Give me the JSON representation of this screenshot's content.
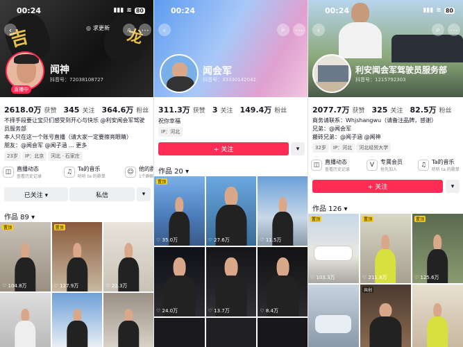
{
  "status": {
    "time": "00:24",
    "battery": "80"
  },
  "p1": {
    "buttons": {
      "refresh": "求更新"
    },
    "name": "闻神",
    "id": "抖音号：72038108727",
    "live": "直播中",
    "stats": [
      {
        "num": "2618.0万",
        "label": "获赞"
      },
      {
        "num": "345",
        "label": "关注"
      },
      {
        "num": "364.6万",
        "label": "粉丝"
      }
    ],
    "bio1": "不择手段要让宝贝们感受到开心与快乐 @利安闻会军驾驶员服务部",
    "bio2": "本人只在这一个账号直播（请大家一定要擦亮眼睛）",
    "bio3": "朋友：@闻会军 @闻子涵 ... 更多",
    "tags": [
      "23岁",
      "IP：北京",
      "河北 · 石家庄"
    ],
    "icons": [
      {
        "t1": "直播动态",
        "t2": "查看历史记录"
      },
      {
        "t1": "Ta的音乐",
        "t2": "听听 ta 的歌单"
      },
      {
        "t1": "他的群",
        "t2": "1个群聊"
      }
    ],
    "follow_btn": "已关注 ▾",
    "msg_btn": "私信",
    "works": "作品 89 ▾",
    "likes": [
      "104.8万",
      "127.9万",
      "22.3万"
    ],
    "pin": "置顶"
  },
  "p2": {
    "name": "闻会军",
    "id": "抖音号：33330142042",
    "stats": [
      {
        "num": "311.3万",
        "label": "获赞"
      },
      {
        "num": "3",
        "label": "关注"
      },
      {
        "num": "149.4万",
        "label": "粉丝"
      }
    ],
    "bio": "祝你幸福",
    "tags": [
      "IP：河北"
    ],
    "follow_btn": "+ 关注",
    "works": "作品 20 ▾",
    "likes": [
      "35.0万",
      "27.6万",
      "11.5万",
      "24.0万",
      "13.7万",
      "8.4万"
    ],
    "pin": "置顶"
  },
  "p3": {
    "name": "利安闻会军驾驶员服务部",
    "id": "抖音号：1215792303",
    "stats": [
      {
        "num": "2077.7万",
        "label": "获赞"
      },
      {
        "num": "325",
        "label": "关注"
      },
      {
        "num": "82.5万",
        "label": "粉丝"
      }
    ],
    "bio1": "商务请联系：Whjshangwu（请备注品牌，感谢）",
    "bio2": "兄弟：@闻会军",
    "bio3": "搬砖兄弟：@闻子涵 @闻神",
    "tags": [
      "32岁",
      "IP：河北",
      "河北经贸大学"
    ],
    "icons": [
      {
        "t1": "直播动态",
        "t2": "查看历史记录"
      },
      {
        "t1": "专属会员",
        "t2": "抢先加入"
      },
      {
        "t1": "Ta的音乐",
        "t2": "听听 ta 的歌单"
      }
    ],
    "follow_btn": "+ 关注",
    "works": "作品 126 ▾",
    "likes": [
      "103.3万",
      "211.8万",
      "125.6万"
    ],
    "pin": "置顶",
    "cotag": "共创"
  }
}
